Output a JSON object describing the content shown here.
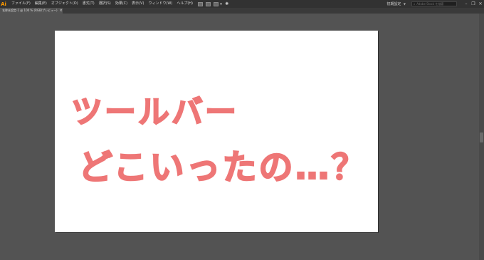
{
  "app": {
    "logo": "Ai",
    "menu": [
      "ファイル(F)",
      "編集(E)",
      "オブジェクト(O)",
      "書式(T)",
      "選択(S)",
      "効果(C)",
      "表示(V)",
      "ウィンドウ(W)",
      "ヘルプ(H)"
    ],
    "workspace": "初期設定",
    "search_placeholder": "Adobe Stock を検索"
  },
  "tab": {
    "title": "名称未設定-1 @ 100 % (RGB/プレビュー)",
    "close": "×"
  },
  "artwork": {
    "line1": "ツールバー",
    "line2": "どこいったの…？",
    "color": "#ee7676"
  }
}
